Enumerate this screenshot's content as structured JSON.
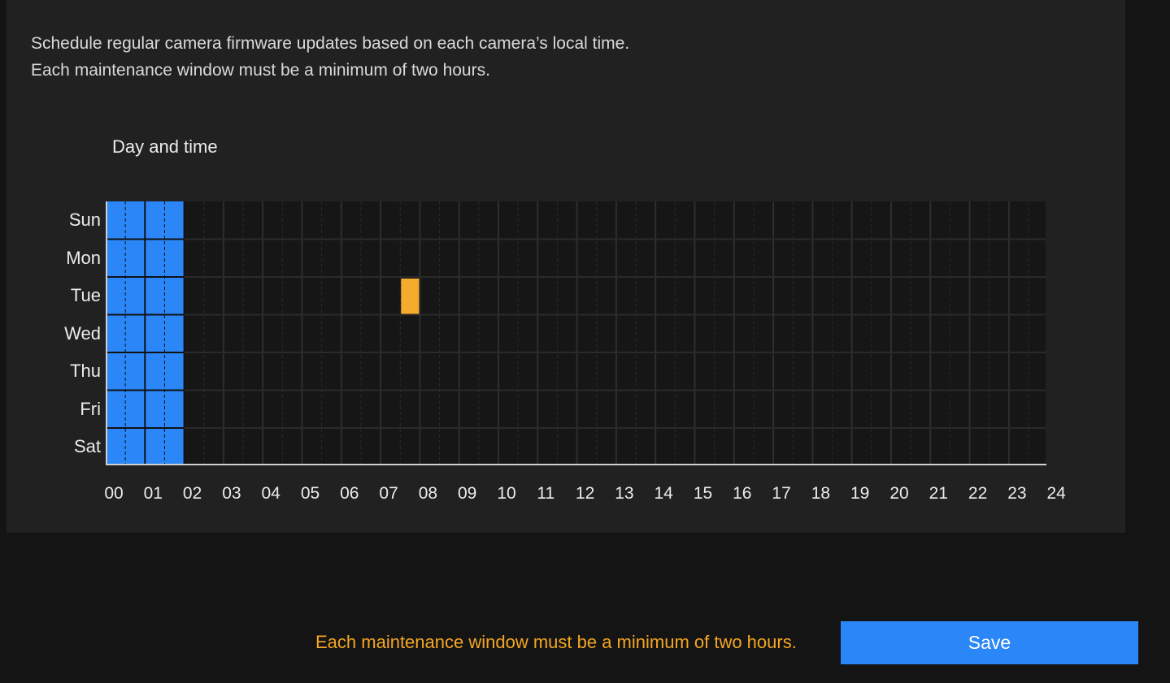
{
  "description": {
    "line1": "Schedule regular camera firmware updates based on each camera’s local time.",
    "line2": "Each maintenance window must be a minimum of two hours."
  },
  "schedule": {
    "label": "Day and time",
    "days": [
      "Sun",
      "Mon",
      "Tue",
      "Wed",
      "Thu",
      "Fri",
      "Sat"
    ],
    "hours": [
      "00",
      "01",
      "02",
      "03",
      "04",
      "05",
      "06",
      "07",
      "08",
      "09",
      "10",
      "11",
      "12",
      "13",
      "14",
      "15",
      "16",
      "17",
      "18",
      "19",
      "20",
      "21",
      "22",
      "23",
      "24"
    ],
    "selected_windows": [
      {
        "day": "Sun",
        "start": "00:00",
        "end": "02:00"
      },
      {
        "day": "Mon",
        "start": "00:00",
        "end": "02:00"
      },
      {
        "day": "Tue",
        "start": "00:00",
        "end": "02:00"
      },
      {
        "day": "Wed",
        "start": "00:00",
        "end": "02:00"
      },
      {
        "day": "Thu",
        "start": "00:00",
        "end": "02:00"
      },
      {
        "day": "Fri",
        "start": "00:00",
        "end": "02:00"
      },
      {
        "day": "Sat",
        "start": "00:00",
        "end": "02:00"
      }
    ],
    "invalid_windows": [
      {
        "day": "Tue",
        "start": "07:30",
        "end": "08:00"
      }
    ],
    "colors": {
      "selected": "#2b87f7",
      "invalid": "#f5ab2e",
      "empty": "#161616",
      "grid_line": "#2e2e2e"
    }
  },
  "footer": {
    "warning": "Each maintenance window must be a minimum of two hours.",
    "save_label": "Save"
  }
}
